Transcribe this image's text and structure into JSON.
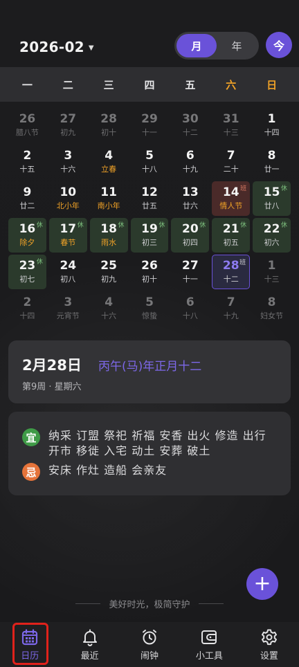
{
  "header": {
    "month_title": "2026-02",
    "view_options": [
      "月",
      "年"
    ],
    "active_view": "月",
    "today_button": "今"
  },
  "weekdays": [
    "一",
    "二",
    "三",
    "四",
    "五",
    "六",
    "日"
  ],
  "calendar": {
    "cells": [
      {
        "day": "26",
        "lunar": "腊八节",
        "dim": true
      },
      {
        "day": "27",
        "lunar": "初九",
        "dim": true
      },
      {
        "day": "28",
        "lunar": "初十",
        "dim": true
      },
      {
        "day": "29",
        "lunar": "十一",
        "dim": true
      },
      {
        "day": "30",
        "lunar": "十二",
        "dim": true
      },
      {
        "day": "31",
        "lunar": "十三",
        "dim": true
      },
      {
        "day": "1",
        "lunar": "十四"
      },
      {
        "day": "2",
        "lunar": "十五"
      },
      {
        "day": "3",
        "lunar": "十六"
      },
      {
        "day": "4",
        "lunar": "立春",
        "festival": true
      },
      {
        "day": "5",
        "lunar": "十八"
      },
      {
        "day": "6",
        "lunar": "十九"
      },
      {
        "day": "7",
        "lunar": "二十"
      },
      {
        "day": "8",
        "lunar": "廿一"
      },
      {
        "day": "9",
        "lunar": "廿二"
      },
      {
        "day": "10",
        "lunar": "北小年",
        "festival": true
      },
      {
        "day": "11",
        "lunar": "南小年",
        "festival": true
      },
      {
        "day": "12",
        "lunar": "廿五"
      },
      {
        "day": "13",
        "lunar": "廿六"
      },
      {
        "day": "14",
        "lunar": "情人节",
        "festival": true,
        "tag": "班",
        "style": "red"
      },
      {
        "day": "15",
        "lunar": "廿八",
        "tag": "休",
        "style": "rest"
      },
      {
        "day": "16",
        "lunar": "除夕",
        "festival": true,
        "tag": "休",
        "style": "rest"
      },
      {
        "day": "17",
        "lunar": "春节",
        "festival": true,
        "tag": "休",
        "style": "rest"
      },
      {
        "day": "18",
        "lunar": "雨水",
        "festival": true,
        "tag": "休",
        "style": "rest"
      },
      {
        "day": "19",
        "lunar": "初三",
        "tag": "休",
        "style": "rest"
      },
      {
        "day": "20",
        "lunar": "初四",
        "tag": "休",
        "style": "rest"
      },
      {
        "day": "21",
        "lunar": "初五",
        "tag": "休",
        "style": "rest"
      },
      {
        "day": "22",
        "lunar": "初六",
        "tag": "休",
        "style": "rest"
      },
      {
        "day": "23",
        "lunar": "初七",
        "tag": "休",
        "style": "rest"
      },
      {
        "day": "24",
        "lunar": "初八"
      },
      {
        "day": "25",
        "lunar": "初九"
      },
      {
        "day": "26",
        "lunar": "初十"
      },
      {
        "day": "27",
        "lunar": "十一"
      },
      {
        "day": "28",
        "lunar": "十二",
        "tag": "班",
        "style": "sel"
      },
      {
        "day": "1",
        "lunar": "十三",
        "dim": true
      },
      {
        "day": "2",
        "lunar": "十四",
        "dim": true
      },
      {
        "day": "3",
        "lunar": "元宵节",
        "dim": true
      },
      {
        "day": "4",
        "lunar": "十六",
        "dim": true
      },
      {
        "day": "5",
        "lunar": "惊蛰",
        "dim": true
      },
      {
        "day": "6",
        "lunar": "十八",
        "dim": true
      },
      {
        "day": "7",
        "lunar": "十九",
        "dim": true
      },
      {
        "day": "8",
        "lunar": "妇女节",
        "dim": true
      }
    ]
  },
  "info": {
    "date": "2月28日",
    "lunar": "丙午(马)年正月十二",
    "week": "第9周 · 星期六"
  },
  "almanac": {
    "yi_label": "宜",
    "yi_text": "纳采 订盟 祭祀 祈福 安香 出火 修造 出行 开市 移徙 入宅 动土 安葬 破土",
    "ji_label": "忌",
    "ji_text": "安床 作灶 造船 会亲友"
  },
  "fab_label": "+",
  "slogan": "美好时光，极简守护",
  "tabs": [
    {
      "label": "日历",
      "icon": "calendar-icon",
      "active": true
    },
    {
      "label": "最近",
      "icon": "bell-icon"
    },
    {
      "label": "闹钟",
      "icon": "alarm-clock-icon"
    },
    {
      "label": "小工具",
      "icon": "wallet-icon"
    },
    {
      "label": "设置",
      "icon": "gear-icon"
    }
  ],
  "colors": {
    "accent": "#6a52d9",
    "festival": "#f0a227",
    "rest_bg": "#2b3a2c",
    "work_bg": "#4a2a29",
    "highlight": "#e0221b"
  }
}
